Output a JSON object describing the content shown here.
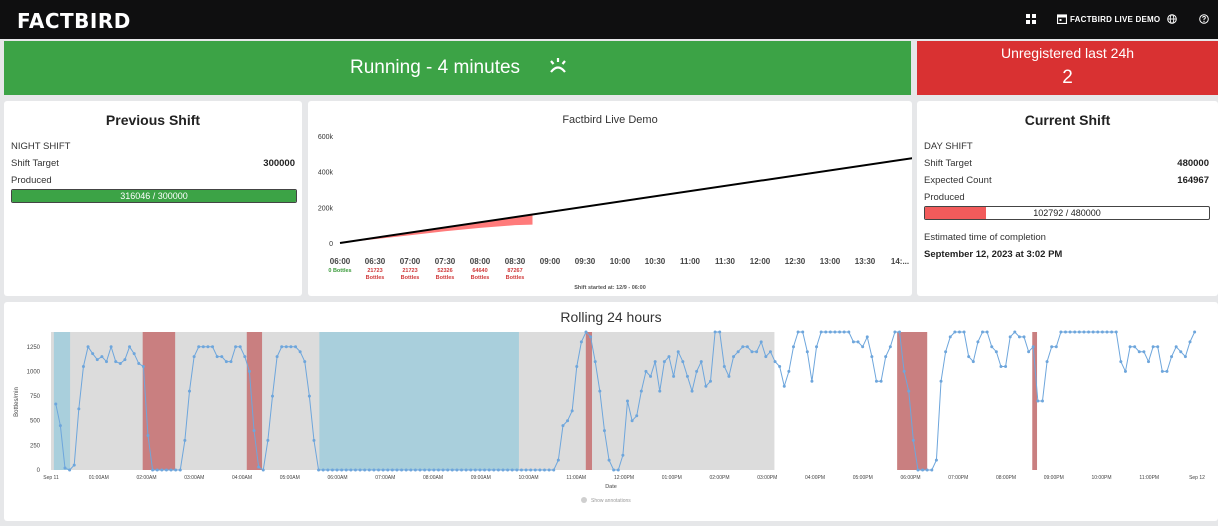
{
  "header": {
    "logo": "FACTBIRD",
    "demo_label": "FACTBIRD LIVE DEMO",
    "icons": [
      "grid-icon",
      "calendar-icon",
      "globe-icon",
      "help-icon"
    ]
  },
  "status": {
    "running_label": "Running - 4 minutes",
    "status_color": "#3ca346",
    "unregistered_label": "Unregistered last 24h",
    "unregistered_count": "2",
    "unregistered_color": "#d93132"
  },
  "previous_shift": {
    "title": "Previous Shift",
    "shift_name": "NIGHT SHIFT",
    "target_label": "Shift Target",
    "target_value": "300000",
    "produced_label": "Produced",
    "produced_text": "316046 / 300000",
    "produced_fraction": 1.0,
    "bar_color": "#3ca346"
  },
  "current_shift": {
    "title": "Current Shift",
    "shift_name": "DAY SHIFT",
    "target_label": "Shift Target",
    "target_value": "480000",
    "expected_label": "Expected Count",
    "expected_value": "164967",
    "produced_label": "Produced",
    "produced_text": "102792 / 480000",
    "produced_fraction": 0.214,
    "bar_color": "#f25b5b",
    "eta_label": "Estimated time of completion",
    "eta_value": "September 12, 2023 at 3:02 PM"
  },
  "chart_data": [
    {
      "type": "line",
      "title": "Factbird Live Demo",
      "footer": "Shift started at: 12/9 - 06:00",
      "ylim": [
        0,
        600000
      ],
      "y_ticks": [
        0,
        200000,
        400000,
        600000
      ],
      "y_tick_labels": [
        "0",
        "200k",
        "400k",
        "600k"
      ],
      "x_labels": [
        "06:00",
        "06:30",
        "07:00",
        "07:30",
        "08:00",
        "08:30",
        "09:00",
        "09:30",
        "10:00",
        "10:30",
        "11:00",
        "11:30",
        "12:00",
        "12:30",
        "13:00",
        "13:30",
        "14:..."
      ],
      "bucket_counts": [
        {
          "value": "0 Bottles",
          "color": "#3a9a3a"
        },
        {
          "value": "21723 Bottles",
          "color": "#d0393a"
        },
        {
          "value": "21723 Bottles",
          "color": "#d0393a"
        },
        {
          "value": "52326 Bottles",
          "color": "#d0393a"
        },
        {
          "value": "64640 Bottles",
          "color": "#d0393a"
        },
        {
          "value": "87267 Bottles",
          "color": "#d0393a"
        }
      ],
      "series": [
        {
          "name": "target",
          "x": [
            0,
            16.5
          ],
          "values": [
            0,
            480000
          ],
          "color": "#000000"
        },
        {
          "name": "produced",
          "x": [
            0,
            1,
            2,
            3,
            4,
            5,
            5.5
          ],
          "values": [
            0,
            21723,
            43446,
            66000,
            85000,
            100000,
            102792
          ],
          "color": "#ff7b7b"
        }
      ],
      "grid": false
    },
    {
      "type": "line",
      "title": "Rolling 24 hours",
      "ylabel": "Bottles/min",
      "xlabel": "Date",
      "ylim": [
        0,
        1400
      ],
      "y_ticks": [
        0,
        250,
        500,
        750,
        1000,
        1250
      ],
      "x_labels": [
        "Sep 11",
        "01:00AM",
        "02:00AM",
        "03:00AM",
        "04:00AM",
        "05:00AM",
        "06:00AM",
        "07:00AM",
        "08:00AM",
        "09:00AM",
        "10:00AM",
        "11:00AM",
        "12:00PM",
        "01:00PM",
        "02:00PM",
        "03:00PM",
        "04:00PM",
        "05:00PM",
        "06:00PM",
        "07:00PM",
        "08:00PM",
        "09:00PM",
        "10:00PM",
        "11:00PM",
        "Sep 12"
      ],
      "legend_label": "Show annotations",
      "series_color": "#6ea6dc",
      "shaded_regions": [
        {
          "from": 0.06,
          "to": 0.4,
          "color": "#a9cfdc"
        },
        {
          "from": 1.92,
          "to": 2.6,
          "color": "#c97f80"
        },
        {
          "from": 4.1,
          "to": 4.42,
          "color": "#c97f80"
        },
        {
          "from": 5.62,
          "to": 9.8,
          "color": "#a9cfdc"
        },
        {
          "from": 11.2,
          "to": 11.33,
          "color": "#c97f80"
        },
        {
          "from": 17.72,
          "to": 18.35,
          "color": "#c97f80"
        },
        {
          "from": 20.55,
          "to": 20.65,
          "color": "#c97f80"
        }
      ],
      "background_region": {
        "from": 0,
        "to": 15.15,
        "color": "#dcdcdc"
      },
      "values": [
        670,
        450,
        20,
        0,
        50,
        620,
        1050,
        1250,
        1180,
        1120,
        1150,
        1100,
        1250,
        1100,
        1080,
        1120,
        1250,
        1180,
        1080,
        1050,
        350,
        0,
        0,
        0,
        0,
        0,
        0,
        0,
        300,
        800,
        1150,
        1250,
        1250,
        1250,
        1250,
        1150,
        1150,
        1100,
        1100,
        1250,
        1250,
        1150,
        1000,
        400,
        30,
        0,
        300,
        750,
        1150,
        1250,
        1250,
        1250,
        1250,
        1200,
        1100,
        750,
        300,
        0,
        0,
        0,
        0,
        0,
        0,
        0,
        0,
        0,
        0,
        0,
        0,
        0,
        0,
        0,
        0,
        0,
        0,
        0,
        0,
        0,
        0,
        0,
        0,
        0,
        0,
        0,
        0,
        0,
        0,
        0,
        0,
        0,
        0,
        0,
        0,
        0,
        0,
        0,
        0,
        0,
        0,
        0,
        0,
        0,
        0,
        0,
        0,
        0,
        0,
        0,
        0,
        100,
        450,
        500,
        600,
        1050,
        1300,
        1400,
        1350,
        1100,
        800,
        400,
        100,
        0,
        0,
        150,
        700,
        500,
        550,
        800,
        1000,
        950,
        1100,
        800,
        1100,
        1150,
        950,
        1200,
        1100,
        950,
        800,
        1000,
        1100,
        850,
        900,
        1400,
        1400,
        1050,
        950,
        1150,
        1200,
        1250,
        1250,
        1200,
        1200,
        1300,
        1150,
        1200,
        1100,
        1050,
        850,
        1000,
        1250,
        1400,
        1400,
        1200,
        900,
        1250,
        1400,
        1400,
        1400,
        1400,
        1400,
        1400,
        1400,
        1300,
        1300,
        1250,
        1350,
        1150,
        900,
        900,
        1150,
        1250,
        1400,
        1400,
        1000,
        800,
        300,
        0,
        0,
        0,
        0,
        100,
        900,
        1200,
        1350,
        1400,
        1400,
        1400,
        1150,
        1100,
        1300,
        1400,
        1400,
        1250,
        1200,
        1050,
        1050,
        1350,
        1400,
        1350,
        1350,
        1200,
        1250,
        700,
        700,
        1100,
        1250,
        1250,
        1400,
        1400,
        1400,
        1400,
        1400,
        1400,
        1400,
        1400,
        1400,
        1400,
        1400,
        1400,
        1400,
        1100,
        1000,
        1250,
        1250,
        1200,
        1200,
        1100,
        1250,
        1250,
        1000,
        1000,
        1150,
        1250,
        1200,
        1150,
        1300,
        1400
      ]
    }
  ]
}
